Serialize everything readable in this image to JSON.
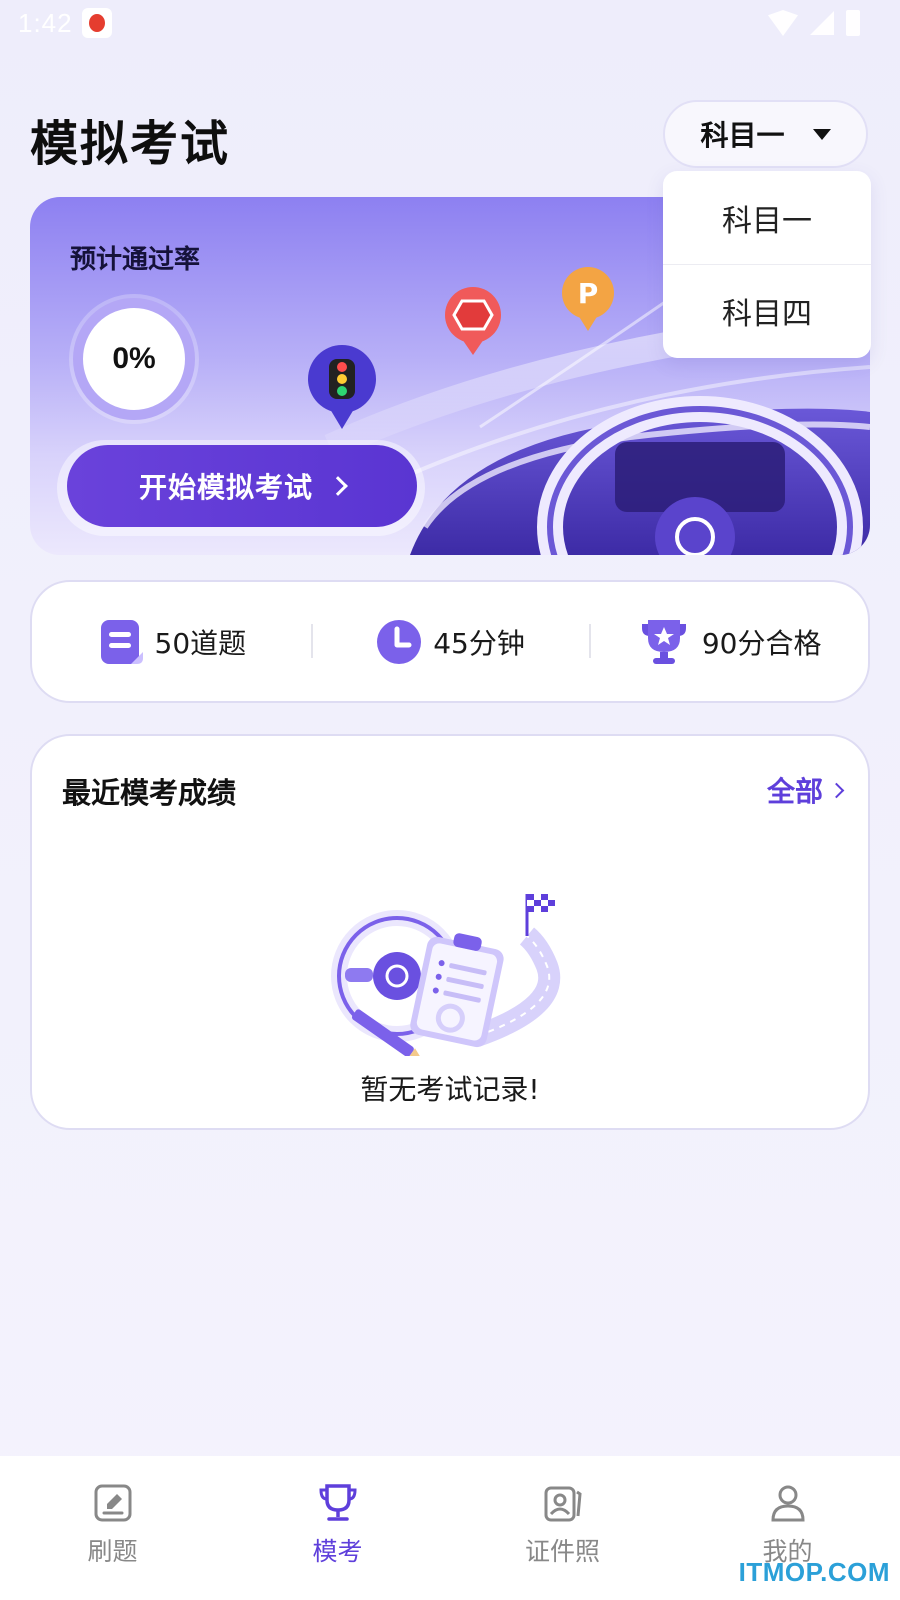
{
  "status_bar": {
    "time": "1:42"
  },
  "header": {
    "title": "模拟考试",
    "subject_selected": "科目一"
  },
  "dropdown": {
    "options": [
      "科目一",
      "科目四"
    ]
  },
  "hero": {
    "pass_rate_label": "预计通过率",
    "pass_rate_value": "0%",
    "start_button_label": "开始模拟考试"
  },
  "info": {
    "questions": "50道题",
    "duration": "45分钟",
    "pass_score": "90分合格"
  },
  "records": {
    "title": "最近模考成绩",
    "all_link": "全部",
    "empty_text": "暂无考试记录!"
  },
  "bottom_nav": {
    "items": [
      {
        "label": "刷题",
        "icon": "edit-icon"
      },
      {
        "label": "模考",
        "icon": "trophy-icon"
      },
      {
        "label": "证件照",
        "icon": "id-photo-icon"
      },
      {
        "label": "我的",
        "icon": "user-icon"
      }
    ]
  },
  "watermark": "ITMOP.COM",
  "colors": {
    "accent": "#5e3fdb",
    "background": "#f1f0fc"
  }
}
